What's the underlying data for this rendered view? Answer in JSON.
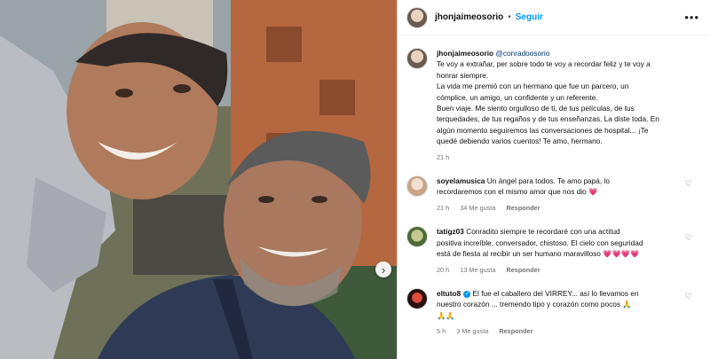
{
  "header": {
    "username": "jhonjaimeosorio",
    "separator": "•",
    "follow_label": "Seguir",
    "more_label": "•••"
  },
  "caption": {
    "username": "jhonjaimeosorio",
    "mention": "@conradoosorio",
    "lines": [
      "Te voy a extrañar, per sobre todo te voy a recordar feliz y te voy a",
      "honrar siempre.",
      "La vida me premió con un hermano que fue un parcero, un",
      "cómplice, un amigo, un confidente y un referente.",
      "Buen viaje. Me siento orgulloso de ti, de tus películas, de tus",
      "terquedades, de tus regaños y de tus enseñanzas. La diste toda. En",
      "algún momento seguiremos las conversaciones de hospital... ¡Te",
      "quedé debiendo varios cuentos! Te amo, hermano."
    ],
    "time": "21 h"
  },
  "comments": [
    {
      "username": "soyelamusica",
      "text_line1": "Un ángel para todos. Te amo papá, lo",
      "text_line2": "recordaremos con el mismo amor que nos dio 💗",
      "time": "21 h",
      "likes": "34 Me gusta",
      "reply": "Responder"
    },
    {
      "username": "tatigz03",
      "text_line1": "Conradito siempre te recordaré con una actitud",
      "text_line2": "positiva increíble, conversador, chistoso. El cielo con seguridad",
      "text_line3": "está de fiesta al recibir un ser humano maravilloso 💗💗💗💗",
      "time": "20 h",
      "likes": "13 Me gusta",
      "reply": "Responder"
    },
    {
      "username": "eltuto8",
      "verified_mark": "✓",
      "text_line1": "El fue el caballero del VIRREY... así lo llevamos en",
      "text_line2": "nuestro corazón ... tremendo tipo y corazón como pocos 🙏",
      "text_line3": "🙏🙏",
      "time": "5 h",
      "likes": "3 Me gusta",
      "reply": "Responder"
    }
  ],
  "photo": {
    "next_arrow": "›"
  },
  "icons": {
    "like": "heart-outline-icon",
    "next": "chevron-right-icon"
  },
  "colors": {
    "follow": "#0095f6",
    "mention": "#00376b",
    "meta": "#737373"
  }
}
